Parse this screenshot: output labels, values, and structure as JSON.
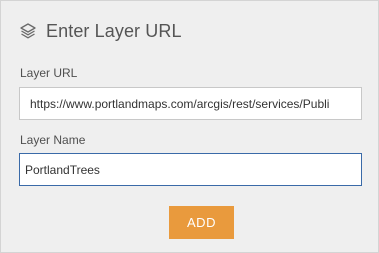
{
  "dialog": {
    "title": "Enter Layer URL",
    "icon": "layers-icon"
  },
  "form": {
    "url_label": "Layer URL",
    "url_value": "https://www.portlandmaps.com/arcgis/rest/services/Publi",
    "name_label": "Layer Name",
    "name_value": "PortlandTrees"
  },
  "actions": {
    "add_label": "ADD"
  },
  "colors": {
    "accent": "#e99a3d",
    "focus_border": "#3a6aa8",
    "panel_bg": "#efefef"
  }
}
